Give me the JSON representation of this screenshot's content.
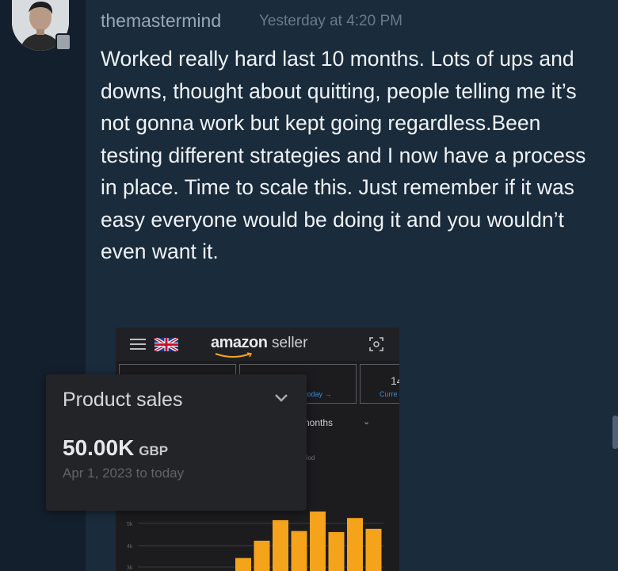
{
  "message": {
    "username": "themastermind",
    "timestamp": "Yesterday at 4:20 PM",
    "text": "Worked really hard last 10 months. Lots of ups and downs, thought about quitting, people telling me it’s not gonna work but kept going regardless.Been testing different strategies and I now have a process in place. Time to scale this. Just remember if it was easy everyone would be doing it and you wouldn’t even want it."
  },
  "attachment": {
    "brand": "amazon",
    "brand_suffix": "seller",
    "cards": [
      {
        "value": "",
        "link": ""
      },
      {
        "value": "",
        "link": "today →"
      },
      {
        "value": "14",
        "link": "Curre"
      }
    ],
    "period_label": "nonths",
    "chart": {
      "type": "bar",
      "values": [
        12,
        28,
        47,
        37,
        55,
        36,
        49,
        39
      ],
      "bar_color": "#f5a31a",
      "grid_labels": [
        "5k",
        "4k",
        "3k"
      ]
    },
    "popup": {
      "title": "Product sales",
      "value": "50.00K",
      "currency": "GBP",
      "range": "Apr 1, 2023 to today"
    }
  },
  "icons": {
    "menu": "hamburger-icon",
    "flag": "uk-flag-icon",
    "scan": "scan-icon",
    "expand": "chevron-down-icon"
  }
}
